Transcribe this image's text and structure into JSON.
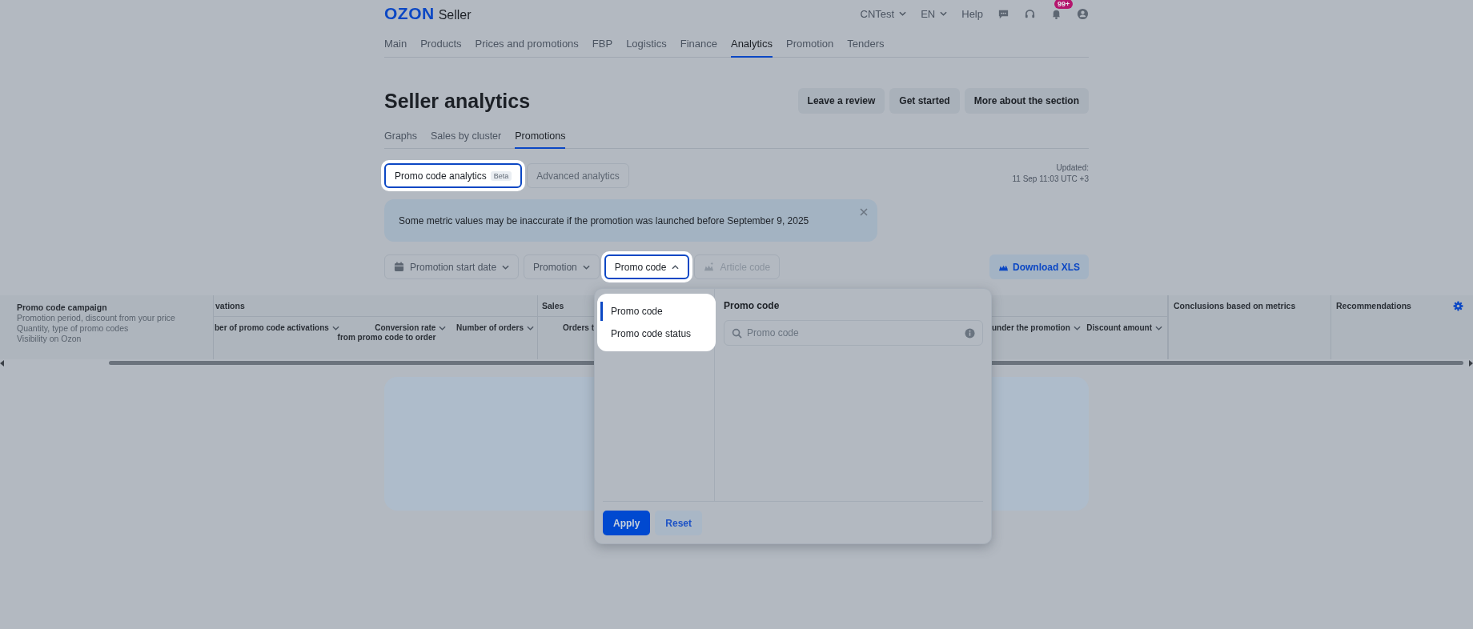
{
  "header": {
    "brand": "OZON",
    "product": "Seller",
    "account": "CNTest",
    "language": "EN",
    "help": "Help",
    "notification_badge": "99+"
  },
  "nav": [
    {
      "label": "Main",
      "selected": false
    },
    {
      "label": "Products",
      "selected": false
    },
    {
      "label": "Prices and promotions",
      "selected": false
    },
    {
      "label": "FBP",
      "selected": false
    },
    {
      "label": "Logistics",
      "selected": false
    },
    {
      "label": "Finance",
      "selected": false
    },
    {
      "label": "Analytics",
      "selected": true
    },
    {
      "label": "Promotion",
      "selected": false
    },
    {
      "label": "Tenders",
      "selected": false
    }
  ],
  "title": "Seller analytics",
  "actions": [
    "Leave a review",
    "Get started",
    "More about the section"
  ],
  "tabs": [
    {
      "label": "Graphs",
      "selected": false
    },
    {
      "label": "Sales by cluster",
      "selected": false
    },
    {
      "label": "Promotions",
      "selected": true
    }
  ],
  "views": [
    {
      "label": "Promo code analytics",
      "badge": "Beta",
      "selected": true
    },
    {
      "label": "Advanced analytics",
      "selected": false
    }
  ],
  "updated": {
    "label": "Updated:",
    "time": "11 Sep 11:03 UTC +3"
  },
  "notice": "Some metric values may be inaccurate if the promotion was launched before September 9, 2025",
  "filters": [
    {
      "label": "Promotion start date",
      "kind": "date",
      "expanded": false,
      "disabled": false
    },
    {
      "label": "Promotion",
      "kind": "select",
      "expanded": false,
      "disabled": false
    },
    {
      "label": "Promo code",
      "kind": "select",
      "expanded": true,
      "disabled": false
    },
    {
      "label": "Article code",
      "kind": "article",
      "expanded": false,
      "disabled": true
    }
  ],
  "download": "Download XLS",
  "table": {
    "campaign": {
      "title": "Promo code campaign",
      "lines": [
        "Promotion period, discount from your price",
        "Quantity, type of promo codes",
        "Visibility on Ozon"
      ]
    },
    "groups": [
      {
        "label": "vations",
        "columns": [
          {
            "label": "ber of promo code activations"
          },
          {
            "label": "Conversion rate",
            "sublabel": "from promo code to order"
          },
          {
            "label": "Number of orders"
          }
        ]
      },
      {
        "label": "Sales",
        "columns": [
          {
            "label": "Orders t"
          }
        ]
      }
    ],
    "right_columns": [
      {
        "label": "under the promotion"
      },
      {
        "label": "Discount amount"
      }
    ],
    "extra_columns": [
      "Conclusions based on metrics",
      "Recommendations"
    ]
  },
  "dropdown": {
    "categories": [
      {
        "label": "Promo code",
        "selected": true
      },
      {
        "label": "Promo code status",
        "selected": false
      }
    ],
    "panel_title": "Promo code",
    "search_placeholder": "Promo code",
    "buttons": [
      {
        "label": "Apply",
        "kind": "primary"
      },
      {
        "label": "Reset",
        "kind": "secondary"
      }
    ]
  }
}
